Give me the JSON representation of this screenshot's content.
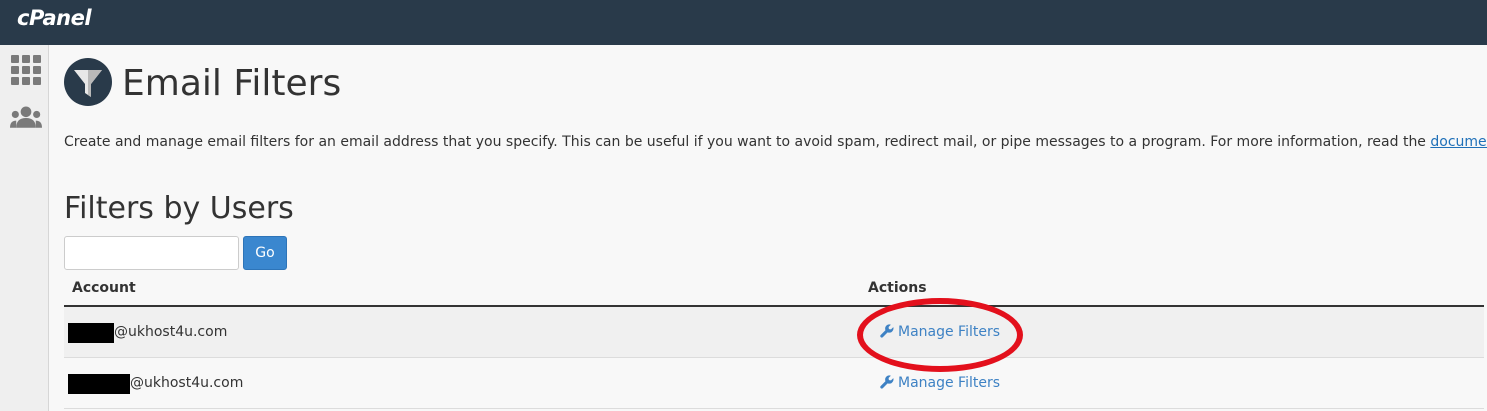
{
  "header": {
    "logo": "cPanel"
  },
  "sidebar": {
    "items": [
      {
        "icon": "grid-icon"
      },
      {
        "icon": "users-icon"
      }
    ]
  },
  "page": {
    "title": "Email Filters",
    "description": "Create and manage email filters for an email address that you specify. This can be useful if you want to avoid spam, redirect mail, or pipe messages to a program. For more information, read the ",
    "doc_link": "documentation",
    "description_end": "."
  },
  "filters": {
    "section_title": "Filters by Users",
    "search_value": "",
    "go_label": "Go",
    "columns": {
      "account": "Account",
      "actions": "Actions"
    },
    "rows": [
      {
        "account": "@ukhost4u.com",
        "action": "Manage Filters"
      },
      {
        "account": "@ukhost4u.com",
        "action": "Manage Filters"
      }
    ]
  },
  "colors": {
    "topbar": "#293a4a",
    "primary_button": "#3a87cf",
    "link": "#3e82c4",
    "highlight": "#e3101c"
  }
}
